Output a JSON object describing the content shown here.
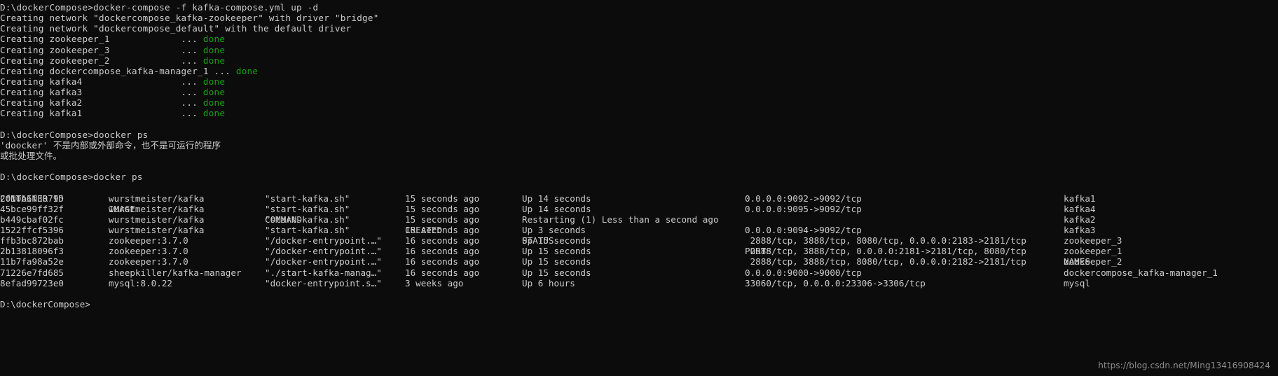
{
  "theme": {
    "background": "#0c0c0c",
    "foreground": "#cccccc",
    "success_color": "#13a10e",
    "watermark_color": "#8d8d8d"
  },
  "prompts": {
    "compose": "D:\\dockerCompose>docker-compose -f kafka-compose.yml up -d",
    "bad_command": "D:\\dockerCompose>doocker ps",
    "docker_ps": "D:\\dockerCompose>docker ps",
    "final": "D:\\dockerCompose>"
  },
  "compose_output": {
    "networks": [
      "Creating network \"dockercompose_kafka-zookeeper\" with driver \"bridge\"",
      "Creating network \"dockercompose_default\" with the default driver"
    ],
    "services": [
      {
        "label": "Creating zookeeper_1",
        "dots": "... ",
        "status": "done"
      },
      {
        "label": "Creating zookeeper_3",
        "dots": "... ",
        "status": "done"
      },
      {
        "label": "Creating zookeeper_2",
        "dots": "... ",
        "status": "done"
      },
      {
        "label": "Creating dockercompose_kafka-manager_1",
        "dots": "... ",
        "status": "done"
      },
      {
        "label": "Creating kafka4",
        "dots": "... ",
        "status": "done"
      },
      {
        "label": "Creating kafka3",
        "dots": "... ",
        "status": "done"
      },
      {
        "label": "Creating kafka2",
        "dots": "... ",
        "status": "done"
      },
      {
        "label": "Creating kafka1",
        "dots": "... ",
        "status": "done"
      }
    ],
    "service_dot_column": 33
  },
  "error_output": {
    "line1": "'doocker' 不是内部或外部命令，也不是可运行的程序",
    "line2": "或批处理文件。"
  },
  "docker_ps_table": {
    "headers": {
      "container_id": "CONTAINER ID",
      "image": "IMAGE",
      "command": "COMMAND",
      "created": "CREATED",
      "status": "STATUS",
      "ports": "PORTS",
      "names": "NAMES"
    },
    "rows": [
      {
        "container_id": "2f10b6f30795",
        "image": "wurstmeister/kafka",
        "command": "\"start-kafka.sh\"",
        "created": "15 seconds ago",
        "status": "Up 14 seconds",
        "ports": "0.0.0.0:9092->9092/tcp",
        "names": "kafka1"
      },
      {
        "container_id": "45bce99ff32f",
        "image": "wurstmeister/kafka",
        "command": "\"start-kafka.sh\"",
        "created": "15 seconds ago",
        "status": "Up 14 seconds",
        "ports": "0.0.0.0:9095->9092/tcp",
        "names": "kafka4"
      },
      {
        "container_id": "b449cbaf02fc",
        "image": "wurstmeister/kafka",
        "command": "\"start-kafka.sh\"",
        "created": "15 seconds ago",
        "status": "Restarting (1) Less than a second ago",
        "ports": "",
        "names": "kafka2"
      },
      {
        "container_id": "1522ffcf5396",
        "image": "wurstmeister/kafka",
        "command": "\"start-kafka.sh\"",
        "created": "15 seconds ago",
        "status": "Up 3 seconds",
        "ports": "0.0.0.0:9094->9092/tcp",
        "names": "kafka3"
      },
      {
        "container_id": "ffb3bc872bab",
        "image": "zookeeper:3.7.0",
        "command": "\"/docker-entrypoint.…\"",
        "created": "16 seconds ago",
        "status": "Up 15 seconds",
        "ports": " 2888/tcp, 3888/tcp, 8080/tcp, 0.0.0.0:2183->2181/tcp",
        "names": "zookeeper_3"
      },
      {
        "container_id": "2b13818096f3",
        "image": "zookeeper:3.7.0",
        "command": "\"/docker-entrypoint.…\"",
        "created": "16 seconds ago",
        "status": "Up 15 seconds",
        "ports": " 2888/tcp, 3888/tcp, 0.0.0.0:2181->2181/tcp, 8080/tcp",
        "names": "zookeeper_1"
      },
      {
        "container_id": "11b7fa98a52e",
        "image": "zookeeper:3.7.0",
        "command": "\"/docker-entrypoint.…\"",
        "created": "16 seconds ago",
        "status": "Up 15 seconds",
        "ports": " 2888/tcp, 3888/tcp, 8080/tcp, 0.0.0.0:2182->2181/tcp",
        "names": "zookeeper_2"
      },
      {
        "container_id": "71226e7fd685",
        "image": "sheepkiller/kafka-manager",
        "command": "\"./start-kafka-manag…\"",
        "created": "16 seconds ago",
        "status": "Up 15 seconds",
        "ports": "0.0.0.0:9000->9000/tcp",
        "names": "dockercompose_kafka-manager_1"
      },
      {
        "container_id": "8efad99723e0",
        "image": "mysql:8.0.22",
        "command": "\"docker-entrypoint.s…\"",
        "created": "3 weeks ago",
        "status": "Up 6 hours",
        "ports": "33060/tcp, 0.0.0.0:23306->3306/tcp",
        "names": "mysql"
      }
    ]
  },
  "watermark": {
    "text": "https://blog.csdn.net/Ming13416908424"
  }
}
